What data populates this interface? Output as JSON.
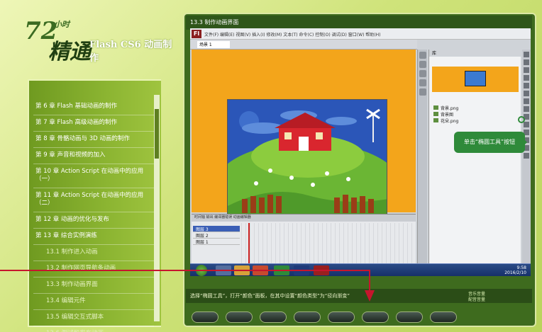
{
  "logo": {
    "number": "72",
    "hours_label": "小时",
    "jing_label": "精通",
    "subtitle": "Flash CS6 动画制作"
  },
  "chapters": [
    {
      "label": "第 6 章  Flash 基础动画的制作",
      "sub": false
    },
    {
      "label": "第 7 章  Flash 高级动画的制作",
      "sub": false
    },
    {
      "label": "第 8 章  骨骼动画与 3D 动画的制作",
      "sub": false
    },
    {
      "label": "第 9 章  声音和视频的加入",
      "sub": false
    },
    {
      "label": "第 10 章  Action  Script 在动画中的应用（一）",
      "sub": false
    },
    {
      "label": "第 11 章  Action  Script 在动画中的应用（二）",
      "sub": false
    },
    {
      "label": "第 12 章  动画的优化与发布",
      "sub": false
    },
    {
      "label": "第 13 章  综合实例演练",
      "sub": false
    },
    {
      "label": "13.1  制作进入动画",
      "sub": true
    },
    {
      "label": "13.2  制作网页导航条动画",
      "sub": true
    },
    {
      "label": "13.3  制作动画界面",
      "sub": true
    },
    {
      "label": "13.4  编辑元件",
      "sub": true
    },
    {
      "label": "13.5  编辑交互式脚本",
      "sub": true
    },
    {
      "label": "13.6  测试和发布动画",
      "sub": true
    }
  ],
  "screen": {
    "title": "13.3  制作动画界面",
    "app_logo": "Fl",
    "menu_items": "文件(F)   编辑(E)   视图(V)   插入(I)   修改(M)   文本(T)   命令(C)   控制(O)   调试(D)   窗口(W)   帮助(H)",
    "scene_tab": "场景 1",
    "zoom": "显示全帧",
    "timeline_tabs": "时间轴    输出    编译器错误    动画编辑器",
    "layers": [
      "图层 3",
      "图层 2",
      "图层 1"
    ],
    "library_tab": "库",
    "library_items": [
      "背景.png",
      "背景图",
      "花朵.png"
    ],
    "clock_time": "9:58",
    "clock_date": "2016/2/10"
  },
  "callout": {
    "text": "单击“椭圆工具”按钮"
  },
  "subtitle": {
    "text": "选择“椭圆工具”，打开“颜色”面板，在其中设置“颜色类型”为“径向渐变”"
  },
  "volume": {
    "music_label": "音乐音量",
    "voice_label": "配音音量"
  },
  "colors": {
    "accent": "#c7152d",
    "panel_green": "#8cb532",
    "stage_orange": "#f3a51b"
  }
}
